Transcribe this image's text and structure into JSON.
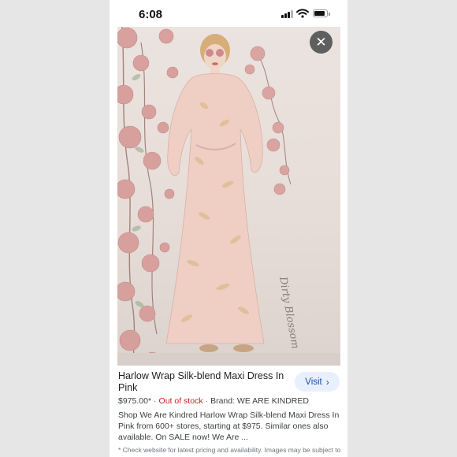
{
  "status_bar": {
    "time": "6:08",
    "icons": [
      "signal-icon",
      "wifi-icon",
      "battery-icon"
    ]
  },
  "image_viewer": {
    "close_icon": "close-icon",
    "close_glyph": "✕",
    "image_description_icon": "product-photo",
    "signature_text": "Dirty Blossom"
  },
  "product": {
    "title": "Harlow Wrap Silk-blend Maxi Dress In Pink",
    "visit_label": "Visit",
    "visit_chevron": "›",
    "price": "$975.00*",
    "separator": "·",
    "stock_status": "Out of stock",
    "brand": "Brand: WE ARE KINDRED",
    "description": "Shop We Are Kindred Harlow Wrap Silk-blend Maxi Dress In Pink from 600+ stores, starting at $975. Similar ones also available. On SALE now! We Are ...",
    "disclaimer": "* Check website for latest pricing and availability. Images may be subject to copyright. Learn More"
  },
  "colors": {
    "visit_bg": "#e8f0fe",
    "visit_text": "#174ea6",
    "out_of_stock": "#c5221f",
    "floral": "#d79a97",
    "dress": "#efcfc4"
  }
}
